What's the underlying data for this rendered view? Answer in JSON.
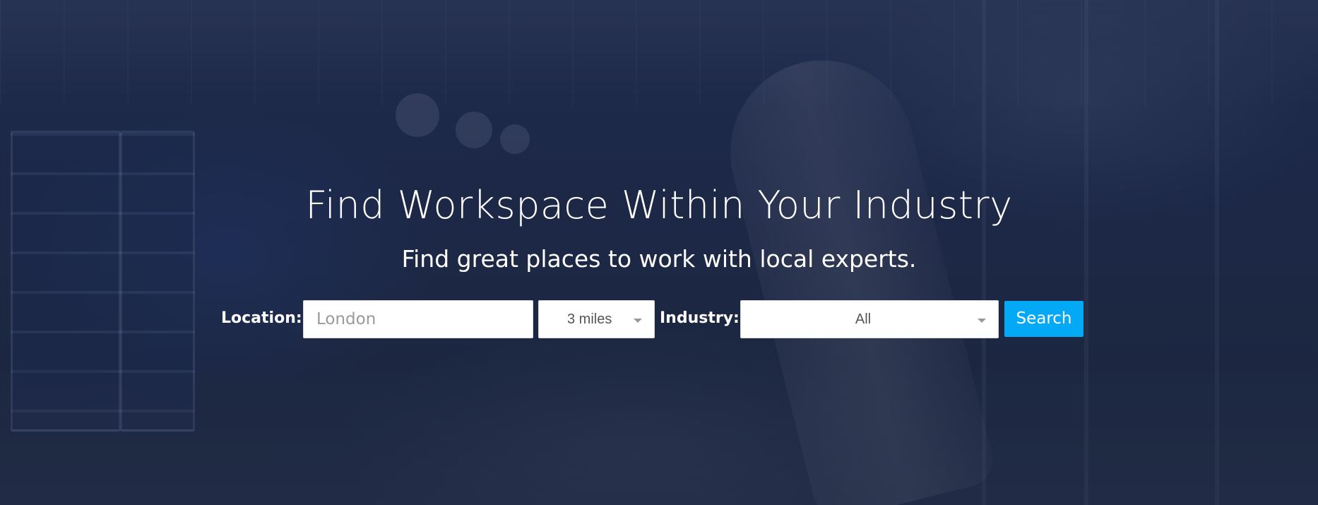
{
  "hero": {
    "title": "Find Workspace Within Your Industry",
    "subtitle": "Find great places to work with local experts."
  },
  "search": {
    "location_label": "Location:",
    "location_placeholder": "London",
    "location_value": "",
    "radius_value": "3 miles",
    "industry_label": "Industry:",
    "industry_value": "All",
    "button_label": "Search"
  },
  "colors": {
    "button_accent": "#03a9f4",
    "overlay": "#1f2c4f",
    "text": "#ffffff"
  },
  "icons": {
    "radius_caret": "chevron-down-icon",
    "industry_caret": "chevron-down-icon"
  }
}
